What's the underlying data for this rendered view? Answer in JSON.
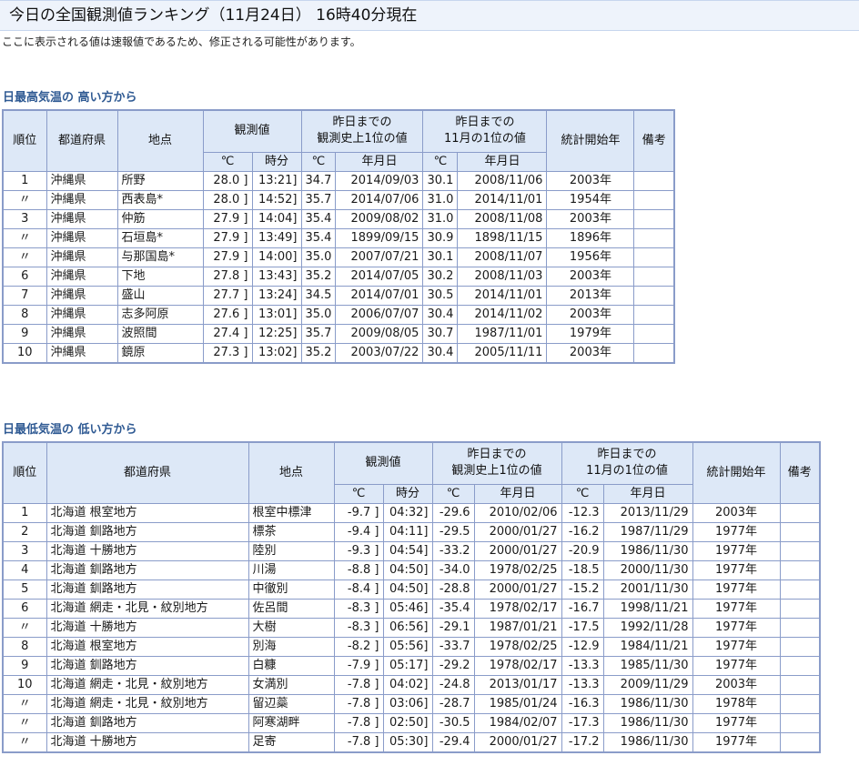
{
  "header": {
    "title": "今日の全国観測値ランキング（11月24日） 16時40分現在",
    "notice": "ここに表示される値は速報値であるため、修正される可能性があります。"
  },
  "columns": {
    "rank": "順位",
    "pref": "都道府県",
    "point": "地点",
    "obs": "観測値",
    "record_line1": "昨日までの",
    "record_line2": "観測史上1位の値",
    "month_line1": "昨日までの",
    "month_line2": "11月の1位の値",
    "start": "統計開始年",
    "note": "備考",
    "celsius": "℃",
    "time": "時分",
    "date": "年月日"
  },
  "max_table": {
    "title": "日最高気温の 高い方から",
    "rows": [
      {
        "rank": "1",
        "pref": "沖縄県",
        "point": "所野",
        "val": "28.0 ]",
        "time": "13:21]",
        "rec": "34.7",
        "rec_date": "2014/09/03",
        "mon": "30.1",
        "mon_date": "2008/11/06",
        "start": "2003年",
        "note": ""
      },
      {
        "rank": "〃",
        "pref": "沖縄県",
        "point": "西表島*",
        "val": "28.0 ]",
        "time": "14:52]",
        "rec": "35.7",
        "rec_date": "2014/07/06",
        "mon": "31.0",
        "mon_date": "2014/11/01",
        "start": "1954年",
        "note": ""
      },
      {
        "rank": "3",
        "pref": "沖縄県",
        "point": "仲筋",
        "val": "27.9 ]",
        "time": "14:04]",
        "rec": "35.4",
        "rec_date": "2009/08/02",
        "mon": "31.0",
        "mon_date": "2008/11/08",
        "start": "2003年",
        "note": ""
      },
      {
        "rank": "〃",
        "pref": "沖縄県",
        "point": "石垣島*",
        "val": "27.9 ]",
        "time": "13:49]",
        "rec": "35.4",
        "rec_date": "1899/09/15",
        "mon": "30.9",
        "mon_date": "1898/11/15",
        "start": "1896年",
        "note": ""
      },
      {
        "rank": "〃",
        "pref": "沖縄県",
        "point": "与那国島*",
        "val": "27.9 ]",
        "time": "14:00]",
        "rec": "35.0",
        "rec_date": "2007/07/21",
        "mon": "30.1",
        "mon_date": "2008/11/07",
        "start": "1956年",
        "note": ""
      },
      {
        "rank": "6",
        "pref": "沖縄県",
        "point": "下地",
        "val": "27.8 ]",
        "time": "13:43]",
        "rec": "35.2",
        "rec_date": "2014/07/05",
        "mon": "30.2",
        "mon_date": "2008/11/03",
        "start": "2003年",
        "note": ""
      },
      {
        "rank": "7",
        "pref": "沖縄県",
        "point": "盛山",
        "val": "27.7 ]",
        "time": "13:24]",
        "rec": "34.5",
        "rec_date": "2014/07/01",
        "mon": "30.5",
        "mon_date": "2014/11/01",
        "start": "2013年",
        "note": ""
      },
      {
        "rank": "8",
        "pref": "沖縄県",
        "point": "志多阿原",
        "val": "27.6 ]",
        "time": "13:01]",
        "rec": "35.0",
        "rec_date": "2006/07/07",
        "mon": "30.4",
        "mon_date": "2014/11/02",
        "start": "2003年",
        "note": ""
      },
      {
        "rank": "9",
        "pref": "沖縄県",
        "point": "波照間",
        "val": "27.4 ]",
        "time": "12:25]",
        "rec": "35.7",
        "rec_date": "2009/08/05",
        "mon": "30.7",
        "mon_date": "1987/11/01",
        "start": "1979年",
        "note": ""
      },
      {
        "rank": "10",
        "pref": "沖縄県",
        "point": "鏡原",
        "val": "27.3 ]",
        "time": "13:02]",
        "rec": "35.2",
        "rec_date": "2003/07/22",
        "mon": "30.4",
        "mon_date": "2005/11/11",
        "start": "2003年",
        "note": ""
      }
    ]
  },
  "min_table": {
    "title": "日最低気温の 低い方から",
    "rows": [
      {
        "rank": "1",
        "pref": "北海道 根室地方",
        "point": "根室中標津",
        "val": "-9.7 ]",
        "time": "04:32]",
        "rec": "-29.6",
        "rec_date": "2010/02/06",
        "mon": "-12.3",
        "mon_date": "2013/11/29",
        "start": "2003年",
        "note": ""
      },
      {
        "rank": "2",
        "pref": "北海道 釧路地方",
        "point": "標茶",
        "val": "-9.4 ]",
        "time": "04:11]",
        "rec": "-29.5",
        "rec_date": "2000/01/27",
        "mon": "-16.2",
        "mon_date": "1987/11/29",
        "start": "1977年",
        "note": ""
      },
      {
        "rank": "3",
        "pref": "北海道 十勝地方",
        "point": "陸別",
        "val": "-9.3 ]",
        "time": "04:54]",
        "rec": "-33.2",
        "rec_date": "2000/01/27",
        "mon": "-20.9",
        "mon_date": "1986/11/30",
        "start": "1977年",
        "note": ""
      },
      {
        "rank": "4",
        "pref": "北海道 釧路地方",
        "point": "川湯",
        "val": "-8.8 ]",
        "time": "04:50]",
        "rec": "-34.0",
        "rec_date": "1978/02/25",
        "mon": "-18.5",
        "mon_date": "2000/11/30",
        "start": "1977年",
        "note": ""
      },
      {
        "rank": "5",
        "pref": "北海道 釧路地方",
        "point": "中徹別",
        "val": "-8.4 ]",
        "time": "04:50]",
        "rec": "-28.8",
        "rec_date": "2000/01/27",
        "mon": "-15.2",
        "mon_date": "2001/11/30",
        "start": "1977年",
        "note": ""
      },
      {
        "rank": "6",
        "pref": "北海道 網走・北見・紋別地方",
        "point": "佐呂間",
        "val": "-8.3 ]",
        "time": "05:46]",
        "rec": "-35.4",
        "rec_date": "1978/02/17",
        "mon": "-16.7",
        "mon_date": "1998/11/21",
        "start": "1977年",
        "note": ""
      },
      {
        "rank": "〃",
        "pref": "北海道 十勝地方",
        "point": "大樹",
        "val": "-8.3 ]",
        "time": "06:56]",
        "rec": "-29.1",
        "rec_date": "1987/01/21",
        "mon": "-17.5",
        "mon_date": "1992/11/28",
        "start": "1977年",
        "note": ""
      },
      {
        "rank": "8",
        "pref": "北海道 根室地方",
        "point": "別海",
        "val": "-8.2 ]",
        "time": "05:56]",
        "rec": "-33.7",
        "rec_date": "1978/02/25",
        "mon": "-12.9",
        "mon_date": "1984/11/21",
        "start": "1977年",
        "note": ""
      },
      {
        "rank": "9",
        "pref": "北海道 釧路地方",
        "point": "白糠",
        "val": "-7.9 ]",
        "time": "05:17]",
        "rec": "-29.2",
        "rec_date": "1978/02/17",
        "mon": "-13.3",
        "mon_date": "1985/11/30",
        "start": "1977年",
        "note": ""
      },
      {
        "rank": "10",
        "pref": "北海道 網走・北見・紋別地方",
        "point": "女満別",
        "val": "-7.8 ]",
        "time": "04:02]",
        "rec": "-24.8",
        "rec_date": "2013/01/17",
        "mon": "-13.3",
        "mon_date": "2009/11/29",
        "start": "2003年",
        "note": ""
      },
      {
        "rank": "〃",
        "pref": "北海道 網走・北見・紋別地方",
        "point": "留辺蘂",
        "val": "-7.8 ]",
        "time": "03:06]",
        "rec": "-28.7",
        "rec_date": "1985/01/24",
        "mon": "-16.3",
        "mon_date": "1986/11/30",
        "start": "1978年",
        "note": ""
      },
      {
        "rank": "〃",
        "pref": "北海道 釧路地方",
        "point": "阿寒湖畔",
        "val": "-7.8 ]",
        "time": "02:50]",
        "rec": "-30.5",
        "rec_date": "1984/02/07",
        "mon": "-17.3",
        "mon_date": "1986/11/30",
        "start": "1977年",
        "note": ""
      },
      {
        "rank": "〃",
        "pref": "北海道 十勝地方",
        "point": "足寄",
        "val": "-7.8 ]",
        "time": "05:30]",
        "rec": "-29.4",
        "rec_date": "2000/01/27",
        "mon": "-17.2",
        "mon_date": "1986/11/30",
        "start": "1977年",
        "note": ""
      }
    ]
  }
}
